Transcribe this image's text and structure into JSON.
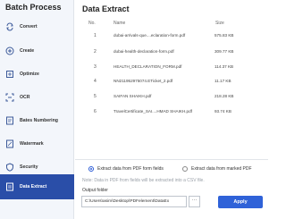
{
  "sidebar": {
    "title": "Batch Process",
    "items": [
      {
        "label": "Convert",
        "icon": "convert-icon"
      },
      {
        "label": "Create",
        "icon": "create-icon"
      },
      {
        "label": "Optimize",
        "icon": "optimize-icon"
      },
      {
        "label": "OCR",
        "icon": "ocr-icon"
      },
      {
        "label": "Bates Numbering",
        "icon": "bates-numbering-icon"
      },
      {
        "label": "Watermark",
        "icon": "watermark-icon"
      },
      {
        "label": "Security",
        "icon": "security-icon"
      },
      {
        "label": "Data Extract",
        "icon": "data-extract-icon",
        "active": true
      }
    ]
  },
  "main": {
    "title": "Data Extract",
    "table": {
      "headers": {
        "no": "No.",
        "name": "Name",
        "size": "Size"
      },
      "rows": [
        {
          "no": "1",
          "name": "dubai-arrivals-que....eclaration-form.pdf",
          "size": "575.83 KB"
        },
        {
          "no": "2",
          "name": "dubai-health-declaration-form.pdf",
          "size": "309.77 KB"
        },
        {
          "no": "3",
          "name": "HEALTH_DECLARATION_FORM.pdf",
          "size": "114.37 KB"
        },
        {
          "no": "4",
          "name": "NN211952975074.ETicket_2.pdf",
          "size": "11.17 KB"
        },
        {
          "no": "5",
          "name": "SAIFAN SHAIKH.pdf",
          "size": "218.28 KB"
        },
        {
          "no": "6",
          "name": "TravelCertificate_SAI....HMAD SHAIKH.pdf",
          "size": "93.74 KB"
        }
      ]
    },
    "options": {
      "form_fields": "Extract data from PDF form fields",
      "marked": "Extract data from marked PDF"
    },
    "note": "Note: Data in PDF from fields will be extracted into a CSV file.",
    "output_folder_label": "Output folder",
    "output_folder_value": "C:\\Users\\asim\\Desktop\\PDFelement\\DataEx",
    "browse_label": "···",
    "apply_label": "Apply"
  },
  "colors": {
    "accent": "#2f62d8",
    "active_nav": "#2a4ea8",
    "sidebar_bg": "#f3f6fb"
  }
}
